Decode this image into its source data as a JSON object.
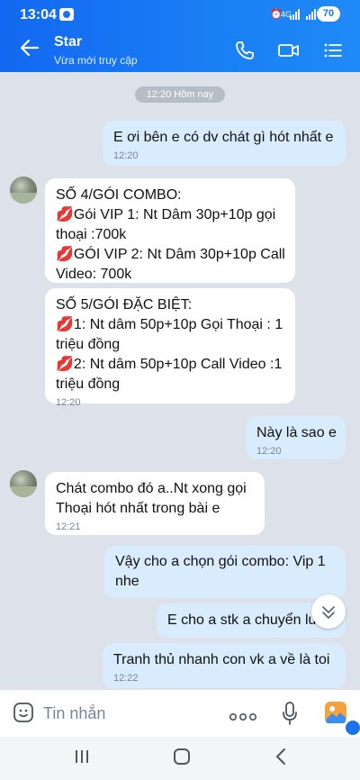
{
  "status_bar": {
    "time": "13:04",
    "network": "4G",
    "battery": "70"
  },
  "header": {
    "title": "Star",
    "subtitle": "Vừa mới truy cập"
  },
  "date_divider": "12:20 Hôm nay",
  "messages": [
    {
      "side": "out",
      "lines": [
        "E ơi bên e có dv chát gì hót nhất e"
      ],
      "time": "12:20"
    },
    {
      "side": "in",
      "lines": [
        "SỐ 4/GÓI COMBO:",
        "💋Gói VIP 1: Nt Dâm 30p+10p gọi",
        "thoại :700k",
        "💋GÓI VIP 2: Nt Dâm 30p+10p Call",
        "Video: 700k"
      ],
      "time": ""
    },
    {
      "side": "in",
      "lines": [
        "SỐ 5/GÓI ĐẶC BIỆT:",
        "💋1: Nt dâm 50p+10p Gọi Thoại : 1",
        "triệu đồng",
        "💋2: Nt dâm 50p+10p Call Video :1",
        "triệu đồng"
      ],
      "time": "12:20"
    },
    {
      "side": "out",
      "lines": [
        "Này là sao e"
      ],
      "time": "12:20"
    },
    {
      "side": "in",
      "lines": [
        "Chát combo đó a..Nt xong gọi",
        "Thoại hót nhất trong bài e"
      ],
      "time": "12:21"
    },
    {
      "side": "out",
      "lines": [
        "Vậy cho a chọn gói combo: Vip 1",
        "nhe"
      ],
      "time": ""
    },
    {
      "side": "out",
      "lines": [
        "E cho a stk a chuyển lu"
      ],
      "time": ""
    },
    {
      "side": "out",
      "lines": [
        "Tranh thủ nhanh con vk a về là toi"
      ],
      "time": "12:22"
    }
  ],
  "composer": {
    "placeholder": "Tin nhắn"
  },
  "colors": {
    "header": "#1a73e8",
    "bubble_out": "#d9ecfd",
    "bubble_in": "#ffffff",
    "background": "#dde2ea"
  }
}
